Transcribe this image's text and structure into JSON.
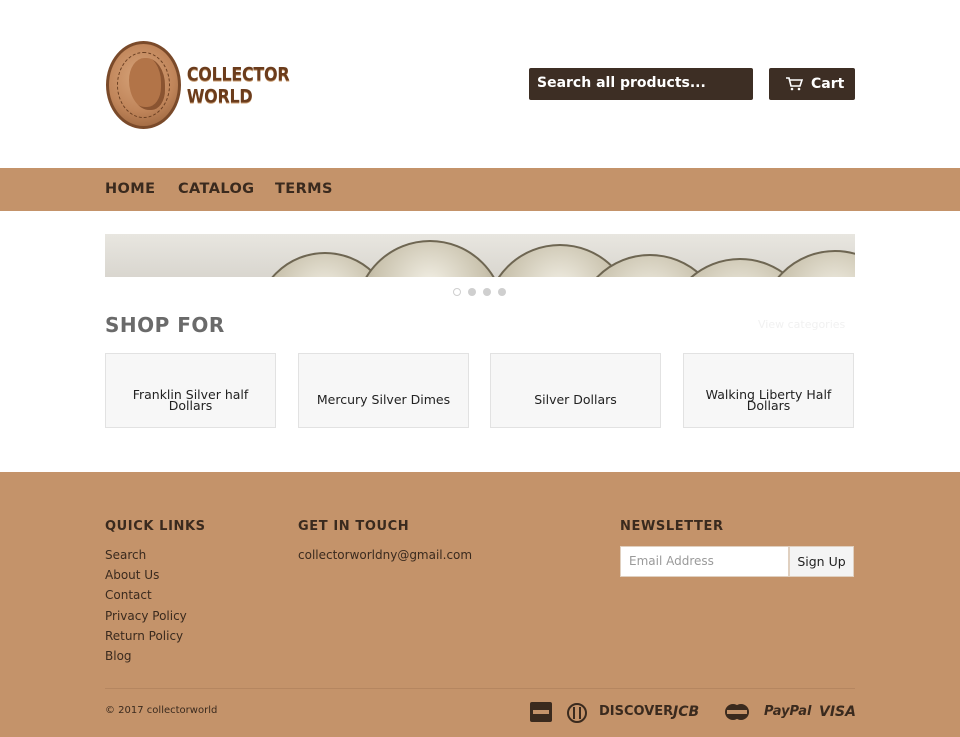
{
  "brand": {
    "logo_text": "COLLECTOR WORLD"
  },
  "header": {
    "search_placeholder": "Search all products...",
    "cart_label": "Cart"
  },
  "nav": {
    "items": [
      "HOME",
      "CATALOG",
      "TERMS"
    ]
  },
  "slider": {
    "dot_count": 4,
    "active_index": 0
  },
  "shop_for": {
    "title": "SHOP FOR",
    "view_link": "View categories",
    "categories": [
      "Franklin Silver half Dollars",
      "Mercury Silver Dimes",
      "Silver Dollars",
      "Walking Liberty Half Dollars"
    ]
  },
  "footer": {
    "quick_links": {
      "heading": "QUICK LINKS",
      "links": [
        "Search",
        "About Us",
        "Contact",
        "Privacy Policy",
        "Return Policy",
        "Blog"
      ]
    },
    "get_in_touch": {
      "heading": "GET IN TOUCH",
      "email": "collectorworldny@gmail.com"
    },
    "newsletter": {
      "heading": "NEWSLETTER",
      "placeholder": "Email Address",
      "button": "Sign Up"
    },
    "copyright": "© 2017 collectorworld",
    "payments": [
      "DISCOVER",
      "JCB",
      "PayPal",
      "VISA"
    ]
  },
  "colors": {
    "brand_tan": "#c4936a",
    "dark_brown": "#3d2e24",
    "text_brown": "#3a2a1e"
  }
}
